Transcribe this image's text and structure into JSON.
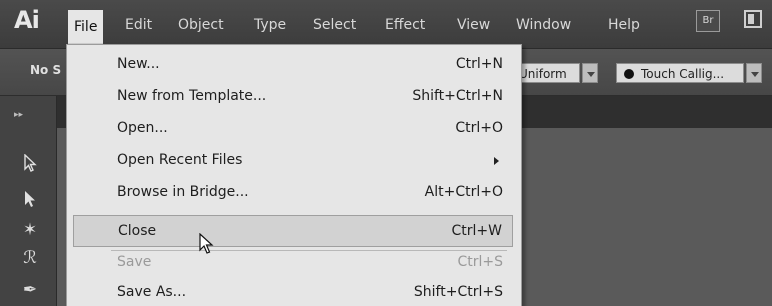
{
  "app": {
    "logo": "Ai"
  },
  "menubar": {
    "items": [
      "File",
      "Edit",
      "Object",
      "Type",
      "Select",
      "Effect",
      "View",
      "Window",
      "Help"
    ],
    "bridge_button": "Br",
    "workspace_icon": "workspace-switcher-icon"
  },
  "controlbar": {
    "no_selection": "No S",
    "profile": "Uniform",
    "brush": "Touch Callig..."
  },
  "tools": {
    "icons": [
      "selection-tool-icon",
      "direct-selection-tool-icon",
      "magic-wand-tool-icon",
      "lasso-tool-icon",
      "pen-tool-icon"
    ]
  },
  "file_menu": {
    "items": [
      {
        "label": "New...",
        "shortcut": "Ctrl+N",
        "state": "enabled"
      },
      {
        "label": "New from Template...",
        "shortcut": "Shift+Ctrl+N",
        "state": "enabled"
      },
      {
        "label": "Open...",
        "shortcut": "Ctrl+O",
        "state": "enabled"
      },
      {
        "label": "Open Recent Files",
        "shortcut": "",
        "state": "submenu"
      },
      {
        "label": "Browse in Bridge...",
        "shortcut": "Alt+Ctrl+O",
        "state": "enabled"
      },
      {
        "label": "Close",
        "shortcut": "Ctrl+W",
        "state": "highlighted"
      },
      {
        "label": "Save",
        "shortcut": "Ctrl+S",
        "state": "disabled"
      },
      {
        "label": "Save As...",
        "shortcut": "Shift+Ctrl+S",
        "state": "enabled"
      }
    ]
  },
  "colors": {
    "menubar": "#3f3f3f",
    "menu_bg": "#e6e6e6",
    "menu_highlight": "#d2d2d2"
  }
}
